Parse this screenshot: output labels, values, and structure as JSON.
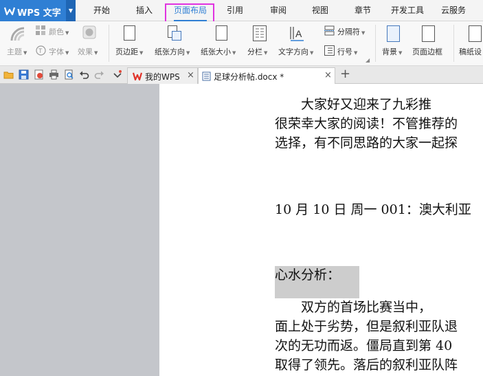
{
  "app": {
    "title": "WPS 文字",
    "colors": {
      "accent": "#2f7fd4",
      "highlight_box": "#e033e0",
      "gray_margin": "#c4c6cb"
    }
  },
  "menu": {
    "tabs": [
      "开始",
      "插入",
      "页面布局",
      "引用",
      "审阅",
      "视图",
      "章节",
      "开发工具",
      "云服务"
    ],
    "active": "页面布局"
  },
  "ribbon": {
    "theme_group": {
      "color": "颜色",
      "theme": "主题",
      "font": "字体",
      "effect": "效果"
    },
    "margins": "页边距",
    "orientation": "纸张方向",
    "size": "纸张大小",
    "columns": "分栏",
    "text_direction": "文字方向",
    "break": "分隔符",
    "line_number": "行号",
    "background": "背景",
    "page_border": "页面边框",
    "manuscript": "稿纸设"
  },
  "tabs": {
    "my_wps": "我的WPS",
    "document": "足球分析帖.docx *"
  },
  "document": {
    "lines": [
      "　　大家好又迎来了九彩推",
      "很荣幸大家的阅读！不管推荐的",
      "选择，有不同思路的大家一起探",
      "10 月 10 日  周一 001：澳大利亚",
      "心水分析：",
      "　　双方的首场比赛当中，",
      "面上处于劣势，但是叙利亚队退",
      "次的无功而返。僵局直到第 40 ",
      "取得了领先。落后的叙利亚队阵"
    ]
  }
}
